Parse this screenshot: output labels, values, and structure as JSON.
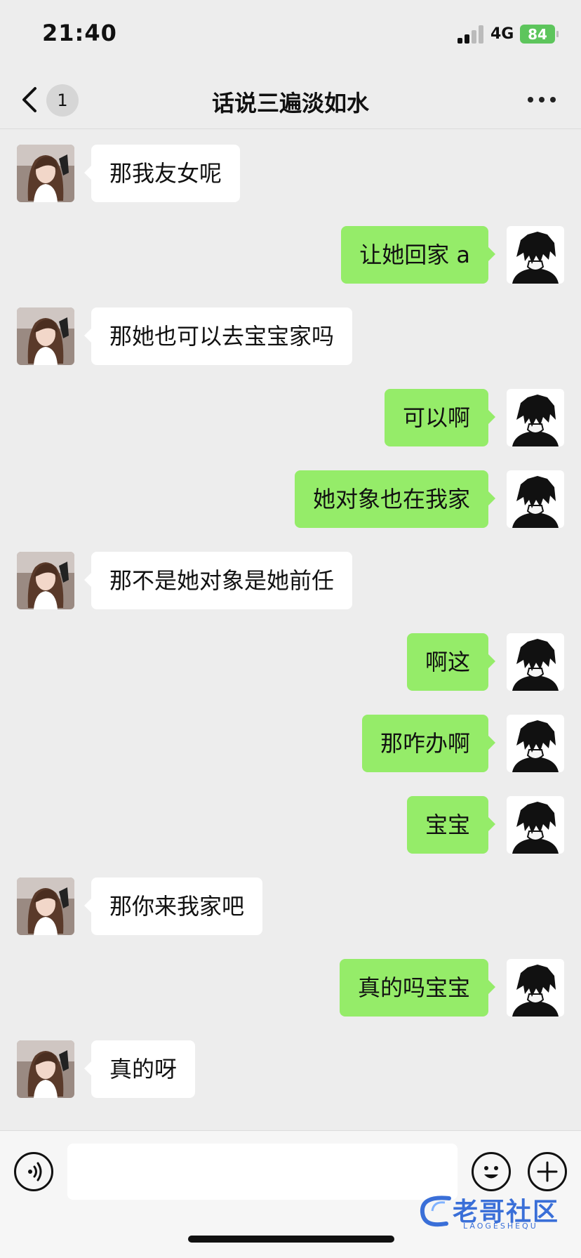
{
  "status_bar": {
    "time": "21:40",
    "network": "4G",
    "battery": "84"
  },
  "nav": {
    "back_count": "1",
    "title": "话说三遍淡如水"
  },
  "messages": [
    {
      "side": "left",
      "text": "那我友女呢"
    },
    {
      "side": "right",
      "text": "让她回家 a"
    },
    {
      "side": "left",
      "text": "那她也可以去宝宝家吗"
    },
    {
      "side": "right",
      "text": "可以啊"
    },
    {
      "side": "right",
      "text": "她对象也在我家"
    },
    {
      "side": "left",
      "text": "那不是她对象是她前任"
    },
    {
      "side": "right",
      "text": "啊这"
    },
    {
      "side": "right",
      "text": "那咋办啊"
    },
    {
      "side": "right",
      "text": "宝宝"
    },
    {
      "side": "left",
      "text": "那你来我家吧"
    },
    {
      "side": "right",
      "text": "真的吗宝宝"
    },
    {
      "side": "left",
      "text": "真的呀"
    }
  ],
  "input_bar": {
    "value": ""
  },
  "watermark": {
    "text": "老哥社区",
    "sub": "LAOGESHEQU"
  },
  "colors": {
    "sent_bubble": "#95ec69",
    "received_bubble": "#ffffff",
    "background": "#ededed",
    "battery": "#5dc55c"
  }
}
